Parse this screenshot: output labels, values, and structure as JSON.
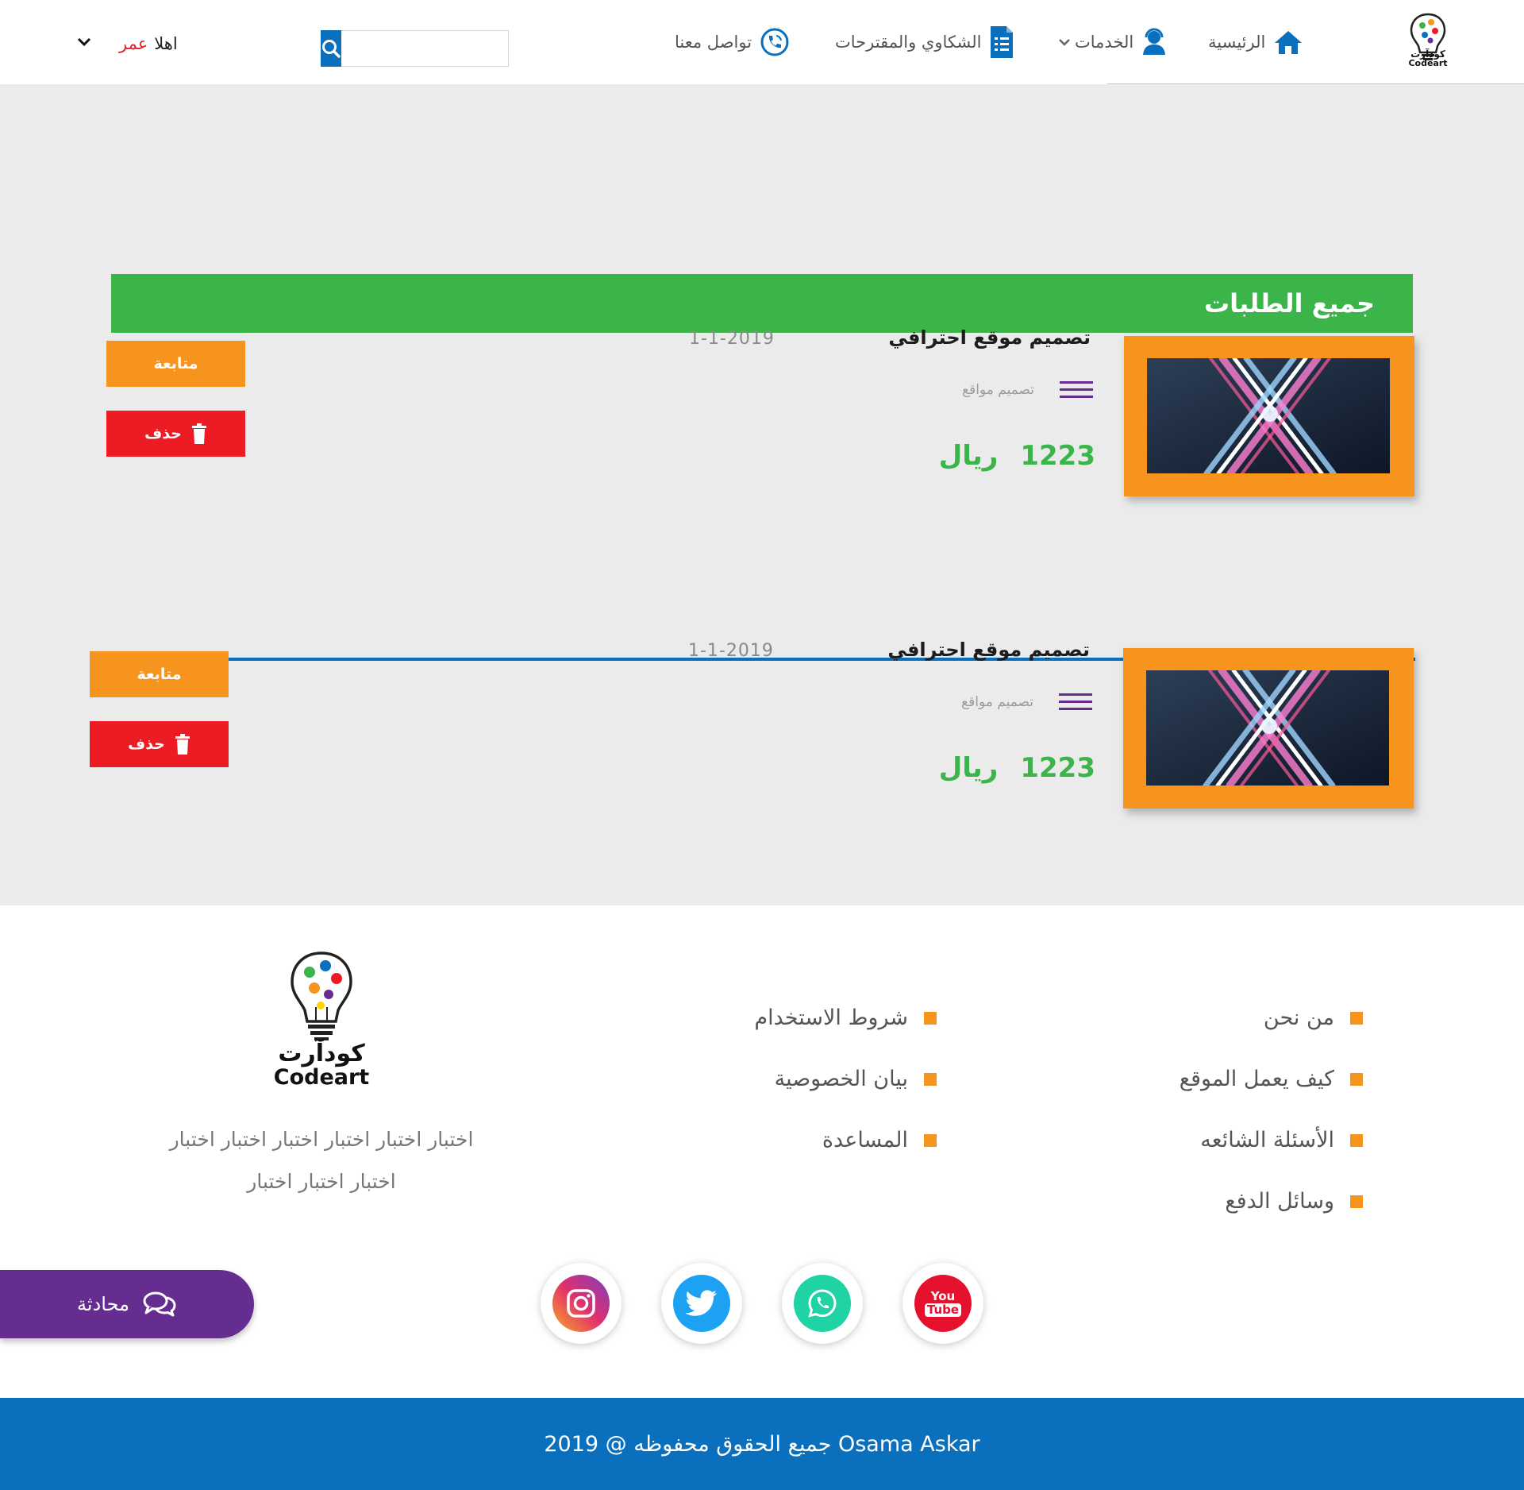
{
  "header": {
    "brand": {
      "ar": "كودآرت",
      "en": "Codeart"
    },
    "nav": [
      {
        "label": "الرئيسية",
        "icon": "home-icon"
      },
      {
        "label": "الخدمات",
        "icon": "support-agent-icon",
        "dropdown": true
      },
      {
        "label": "الشكاوي والمقترحات",
        "icon": "clipboard-checklist-icon"
      },
      {
        "label": "تواصل معنا",
        "icon": "phone-call-icon"
      }
    ],
    "search": {
      "placeholder": "",
      "value": ""
    },
    "greeting": {
      "hello": "اهلا",
      "user": "عمر"
    }
  },
  "main": {
    "title": "جميع الطلبات",
    "orders": [
      {
        "title": "تصميم موقع احترافي",
        "category": "تصميم مواقع",
        "date": "1-1-2019",
        "price": "1223",
        "currency": "ريال",
        "follow_label": "متابعة",
        "delete_label": "حذف"
      },
      {
        "title": "تصميم موقع احترافي",
        "category": "تصميم مواقع",
        "date": "1-1-2019",
        "price": "1223",
        "currency": "ريال",
        "follow_label": "متابعة",
        "delete_label": "حذف"
      }
    ]
  },
  "footer": {
    "links_col1": [
      "من نحن",
      "كيف يعمل الموقع",
      "الأسئلة الشائعه",
      "وسائل الدفع"
    ],
    "links_col2": [
      "شروط الاستخدام",
      "بيان الخصوصية",
      "المساعدة"
    ],
    "brand": {
      "ar": "كودآرت",
      "en": "Codeart"
    },
    "description_line1": "اختبار اختبار اختبار اختبار اختبار اختبار",
    "description_line2": "اختبار اختبار اختبار",
    "social": [
      {
        "name": "instagram",
        "icon": "instagram-icon"
      },
      {
        "name": "twitter",
        "icon": "twitter-icon"
      },
      {
        "name": "whatsapp",
        "icon": "whatsapp-icon"
      },
      {
        "name": "youtube",
        "icon": "youtube-icon",
        "text_top": "You",
        "text_bottom": "Tube"
      }
    ],
    "chat_label": "محادثة",
    "copyright": "جميع الحقوق محفوظه @  2019  Osama Askar"
  },
  "colors": {
    "primary_blue": "#0a6fbc",
    "green": "#3bb54a",
    "orange": "#f7941d",
    "red": "#ed1c24",
    "purple": "#662d91",
    "page_gray": "#ebebeb"
  }
}
